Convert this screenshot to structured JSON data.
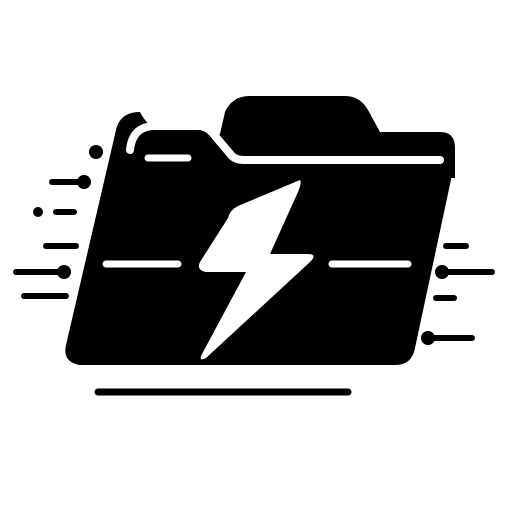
{
  "icon": {
    "name": "fast-folder-icon",
    "symbol": "lightning-bolt",
    "colors": {
      "background": "#ffffff",
      "tile": "#ffffff",
      "foreground": "#000000",
      "accent": "#ffffff"
    }
  }
}
